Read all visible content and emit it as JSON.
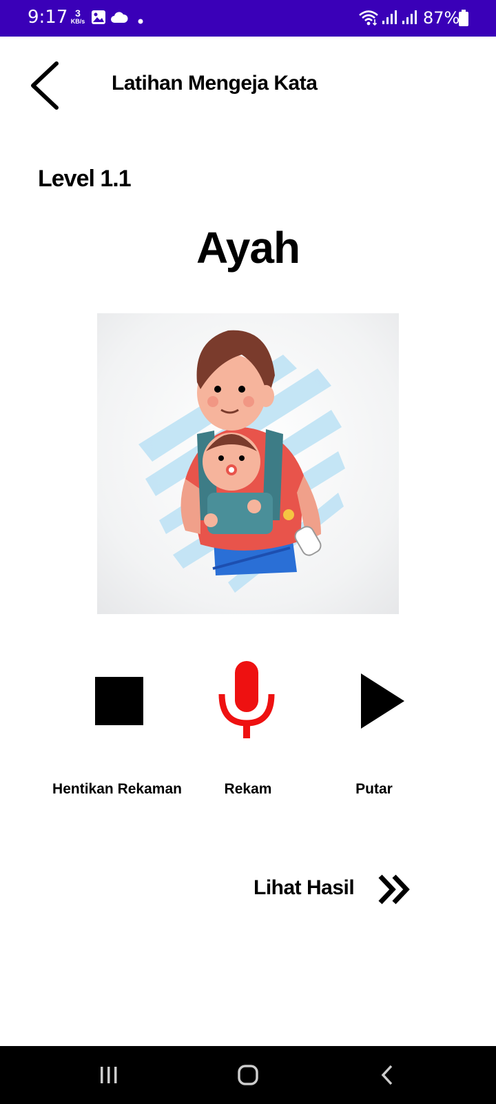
{
  "status_bar": {
    "time": "9:17",
    "net_speed_value": "3",
    "net_speed_unit": "KB/s",
    "battery": "87%",
    "icons": [
      "image-icon",
      "cloud-icon",
      "dot-icon",
      "wifi-icon",
      "signal-icon",
      "signal-icon",
      "battery-icon"
    ]
  },
  "app_bar": {
    "title": "Latihan Mengeja Kata",
    "back_icon": "chevron-left-icon"
  },
  "level": "Level 1.1",
  "word": "Ayah",
  "illustration": "father-carrying-baby-illustration",
  "controls": {
    "stop_label": "Hentikan Rekaman",
    "record_label": "Rekam",
    "play_label": "Putar",
    "record_color": "#ee1111"
  },
  "result_link": {
    "label": "Lihat Hasil",
    "icon": "double-chevron-right-icon"
  },
  "nav_bar": {
    "icons": [
      "recent-apps-icon",
      "home-icon",
      "back-icon"
    ]
  },
  "colors": {
    "status_bar": "#3a00b8",
    "nav_bar": "#000000",
    "accent_red": "#ee1111"
  }
}
